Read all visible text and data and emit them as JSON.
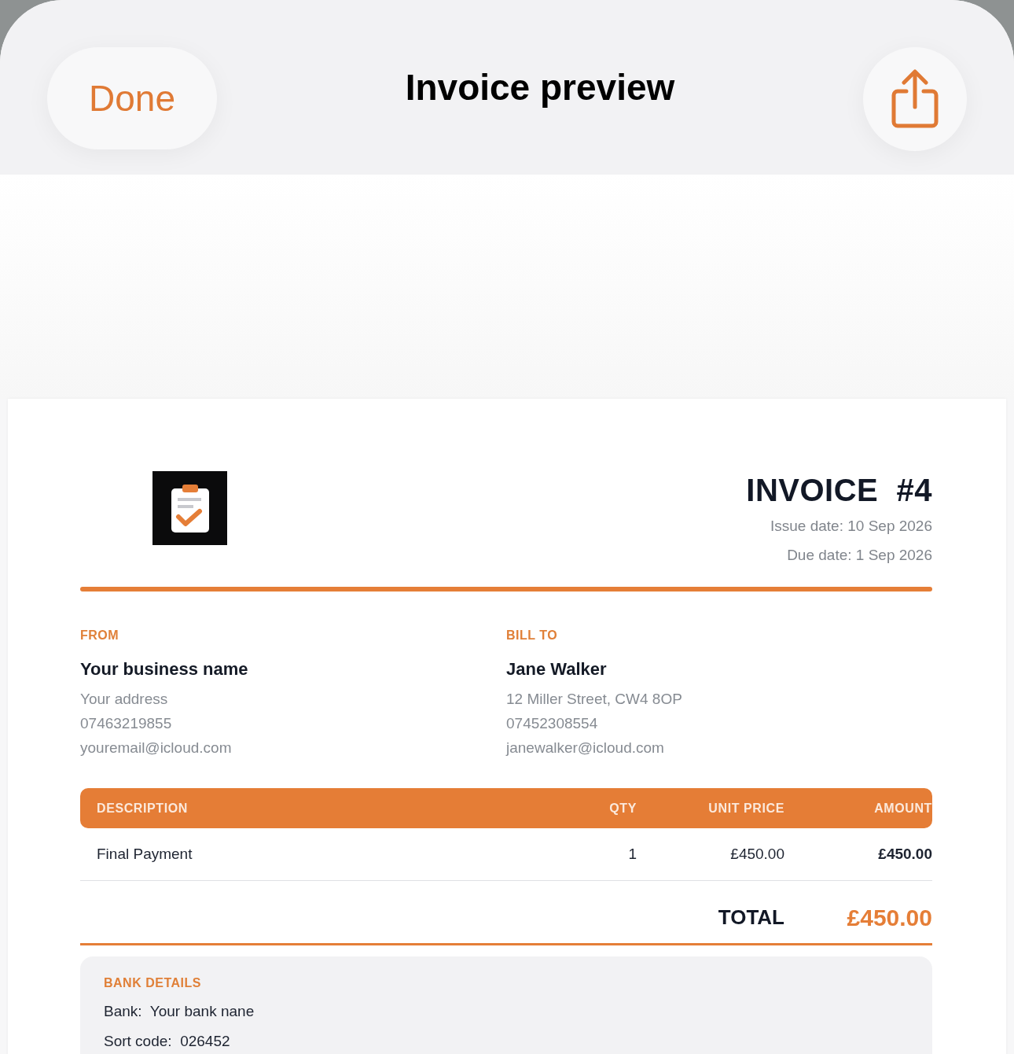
{
  "nav": {
    "done": "Done",
    "title": "Invoice preview"
  },
  "invoice": {
    "title": "INVOICE",
    "number": "#4",
    "issue_date": "Issue date: 10 Sep 2026",
    "due_date": "Due date: 1 Sep 2026"
  },
  "parties": [
    {
      "heading": "FROM",
      "name": "Your business name",
      "lines": [
        "Your address",
        "07463219855",
        "youremail@icloud.com"
      ]
    },
    {
      "heading": "BILL TO",
      "name": "Jane Walker",
      "lines": [
        "12 Miller Street, CW4 8OP",
        "07452308554",
        "janewalker@icloud.com"
      ]
    }
  ],
  "table": {
    "columns": [
      "DESCRIPTION",
      "QTY",
      "UNIT PRICE",
      "AMOUNT"
    ],
    "rows": [
      [
        "Final Payment",
        "1",
        "£450.00",
        "£450.00"
      ]
    ]
  },
  "total": {
    "label": "TOTAL",
    "value": "£450.00"
  },
  "bank": {
    "heading": "BANK DETAILS",
    "rows": [
      {
        "label": "Bank:",
        "value": "Your bank nane"
      },
      {
        "label": "Sort code:",
        "value": "026452"
      }
    ]
  }
}
